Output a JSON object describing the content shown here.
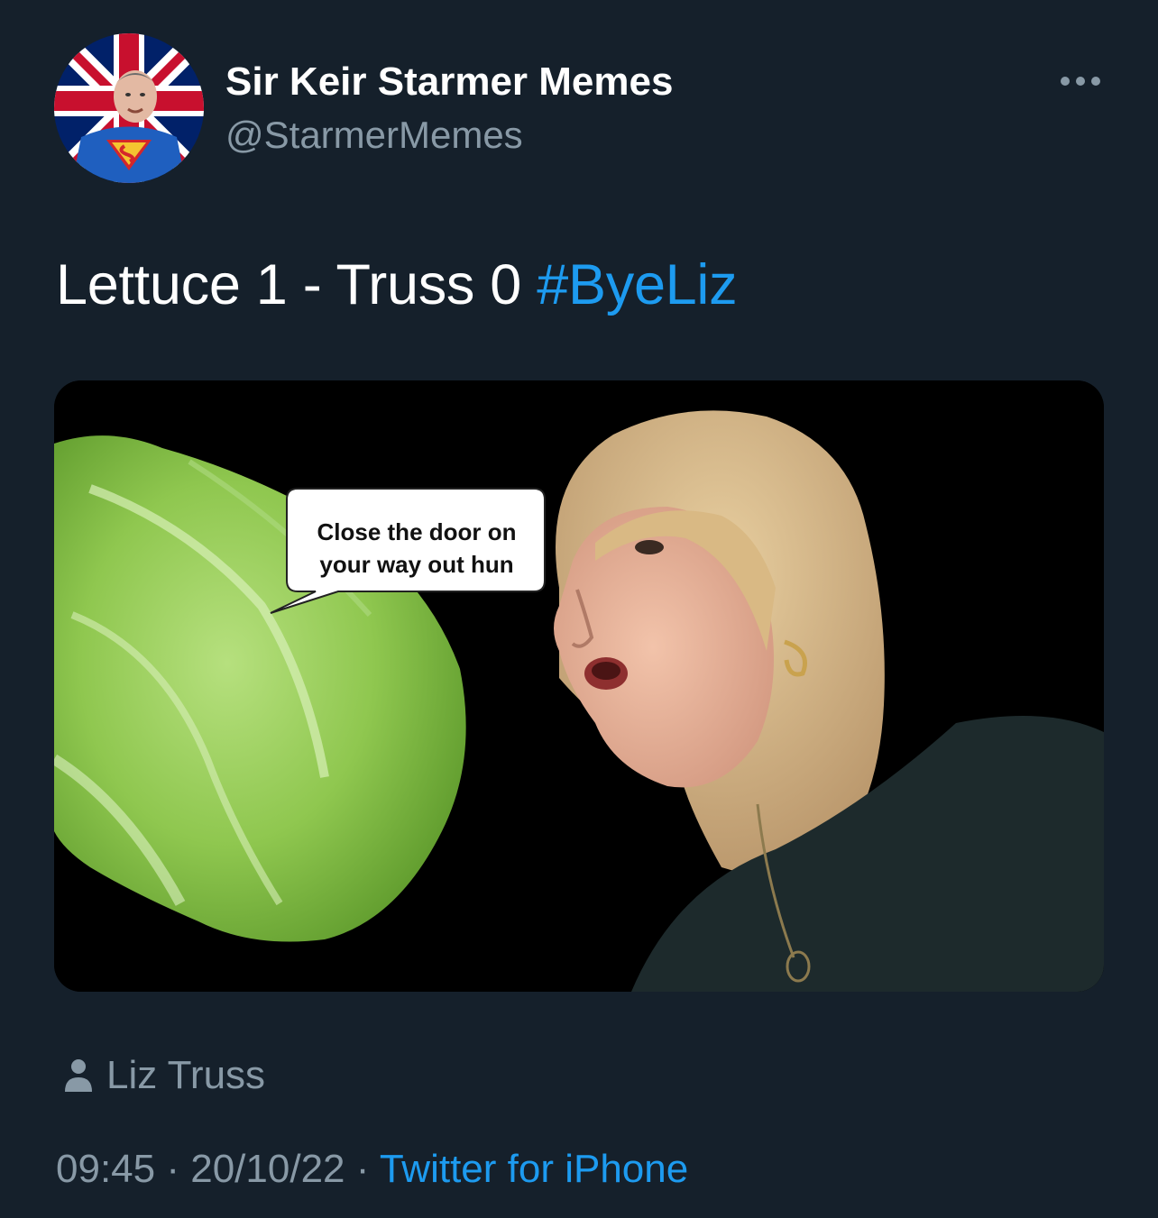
{
  "tweet": {
    "author": {
      "display_name": "Sir Keir Starmer Memes",
      "handle": "@StarmerMemes"
    },
    "text": "Lettuce 1 - Truss 0",
    "hashtag": "#ByeLiz",
    "media": {
      "speech_bubble_line1": "Close the door on",
      "speech_bubble_line2": "your way out hun"
    },
    "tagged_user": "Liz Truss",
    "time": "09:45",
    "separator": "·",
    "date": "20/10/22",
    "source": "Twitter for iPhone"
  },
  "colors": {
    "background": "#15202b",
    "primary_text": "#ffffff",
    "secondary_text": "#8899a6",
    "link": "#1d9bf0"
  },
  "icons": {
    "more": "more-horizontal-icon",
    "tag": "person-icon"
  }
}
